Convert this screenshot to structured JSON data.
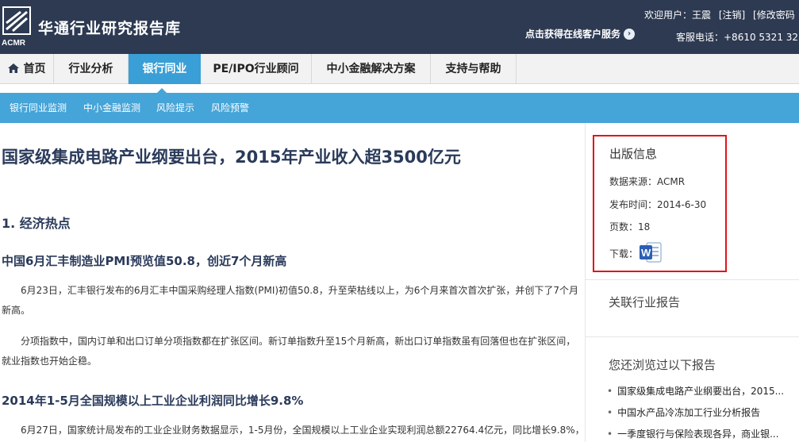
{
  "header": {
    "logo_mark": "ACMR",
    "logo_title": "华通行业研究报告库",
    "service_link": "点击获得在线客户服务",
    "welcome": "欢迎用户：王震",
    "logout": "[注销]",
    "change_password": "[修改密码",
    "hotline": "客服电话：+8610 5321 325"
  },
  "nav": {
    "items": [
      {
        "label": "首页",
        "icon": "home-icon"
      },
      {
        "label": "行业分析"
      },
      {
        "label": "银行同业"
      },
      {
        "label": "PE/IPO行业顾问"
      },
      {
        "label": "中小金融解决方案"
      },
      {
        "label": "支持与帮助"
      }
    ],
    "active_index": 2
  },
  "subnav": {
    "items": [
      "银行同业监测",
      "中小金融监测",
      "风险提示",
      "风险预警"
    ]
  },
  "article": {
    "title": "国家级集成电路产业纲要出台，2015年产业收入超3500亿元",
    "section1": "1. 经济热点",
    "sub1": "中国6月汇丰制造业PMI预览值50.8，创近7个月新高",
    "para1": "6月23日，汇丰银行发布的6月汇丰中国采购经理人指数(PMI)初值50.8，升至荣枯线以上，为6个月来首次首次扩张，并创下了7个月新高。",
    "para2": "分项指数中，国内订单和出口订单分项指数都在扩张区间。新订单指数升至15个月新高，新出口订单指数虽有回落但也在扩张区间，就业指数也开始企稳。",
    "sub2": "2014年1-5月全国规模以上工业企业利润同比增长9.8%",
    "para3": "6月27日，国家统计局发布的工业企业财务数据显示，1-5月份，全国规模以上工业企业实现利润总额22764.4亿元，同比增长9.8%，"
  },
  "sidebar": {
    "pub_title": "出版信息",
    "source": "数据来源：ACMR",
    "date": "发布时间：2014-6-30",
    "pages": "页数：18",
    "download": "下载：",
    "download_icon": "word-document-icon",
    "related_title": "关联行业报告",
    "history_title": "您还浏览过以下报告",
    "history": [
      "国家级集成电路产业纲要出台，2015...",
      "中国水产品冷冻加工行业分析报告",
      "一季度银行与保险表现各异，商业银..."
    ]
  },
  "colors": {
    "header_bg": "#2d3a52",
    "nav_active": "#3a9fd6",
    "subnav_bg": "#45a4d8",
    "highlight_border": "#e0141b",
    "title_color": "#2a3a5a"
  }
}
